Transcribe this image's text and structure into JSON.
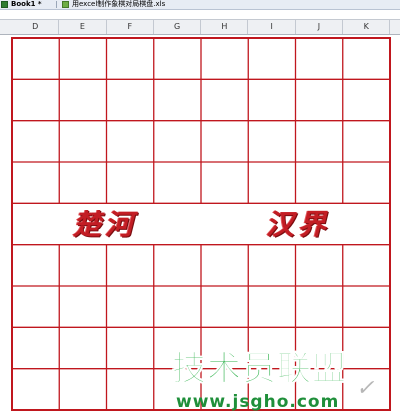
{
  "tabs": [
    {
      "label": "Book1 *",
      "active": true
    },
    {
      "label": "用excel制作象棋对局棋盘.xls",
      "active": false
    }
  ],
  "columns": [
    "D",
    "E",
    "F",
    "G",
    "H",
    "I",
    "J",
    "K"
  ],
  "board": {
    "line_color": "#c0171e",
    "river_left": "楚河",
    "river_right": "汉界"
  },
  "watermark": {
    "brand": "技术员联盟",
    "url": "www.jsgho.com",
    "color": "#2db14a"
  }
}
